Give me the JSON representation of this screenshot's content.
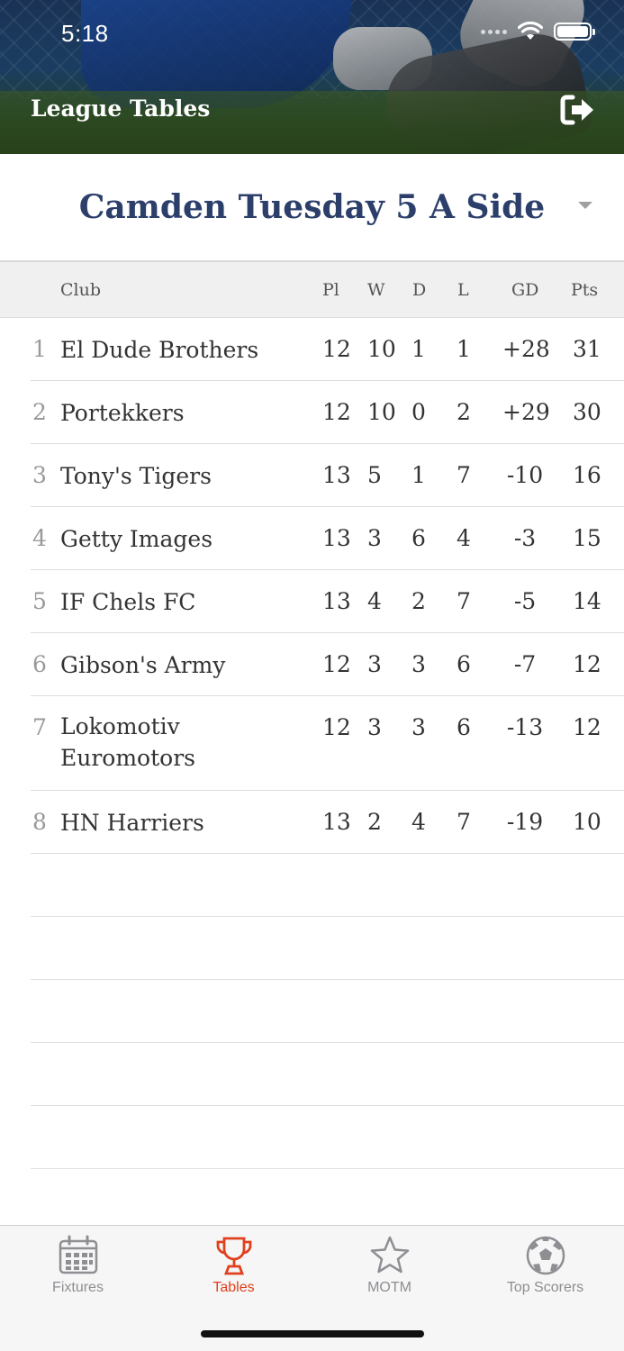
{
  "status_bar": {
    "time": "5:18"
  },
  "header": {
    "title": "League Tables"
  },
  "league": {
    "name": "Camden Tuesday 5 A Side"
  },
  "table": {
    "columns": {
      "club": "Club",
      "pl": "Pl",
      "w": "W",
      "d": "D",
      "l": "L",
      "gd": "GD",
      "pts": "Pts"
    },
    "rows": [
      {
        "pos": "1",
        "club": "El Dude Brothers",
        "pl": "12",
        "w": "10",
        "d": "1",
        "l": "1",
        "gd": "+28",
        "pts": "31"
      },
      {
        "pos": "2",
        "club": "Portekkers",
        "pl": "12",
        "w": "10",
        "d": "0",
        "l": "2",
        "gd": "+29",
        "pts": "30"
      },
      {
        "pos": "3",
        "club": "Tony's Tigers",
        "pl": "13",
        "w": "5",
        "d": "1",
        "l": "7",
        "gd": "-10",
        "pts": "16"
      },
      {
        "pos": "4",
        "club": "Getty Images",
        "pl": "13",
        "w": "3",
        "d": "6",
        "l": "4",
        "gd": "-3",
        "pts": "15"
      },
      {
        "pos": "5",
        "club": "IF Chels FC",
        "pl": "13",
        "w": "4",
        "d": "2",
        "l": "7",
        "gd": "-5",
        "pts": "14"
      },
      {
        "pos": "6",
        "club": "Gibson's Army",
        "pl": "12",
        "w": "3",
        "d": "3",
        "l": "6",
        "gd": "-7",
        "pts": "12"
      },
      {
        "pos": "7",
        "club": "Lokomotiv Euromotors",
        "pl": "12",
        "w": "3",
        "d": "3",
        "l": "6",
        "gd": "-13",
        "pts": "12"
      },
      {
        "pos": "8",
        "club": "HN Harriers",
        "pl": "13",
        "w": "2",
        "d": "4",
        "l": "7",
        "gd": "-19",
        "pts": "10"
      }
    ]
  },
  "tabbar": {
    "tabs": [
      {
        "label": "Fixtures",
        "icon": "calendar-icon",
        "active": false
      },
      {
        "label": "Tables",
        "icon": "trophy-icon",
        "active": true
      },
      {
        "label": "MOTM",
        "icon": "star-icon",
        "active": false
      },
      {
        "label": "Top Scorers",
        "icon": "football-icon",
        "active": false
      }
    ]
  },
  "colors": {
    "accent": "#e0401d",
    "league_title": "#2c3f6b",
    "inactive_tab": "#8e8e93"
  }
}
